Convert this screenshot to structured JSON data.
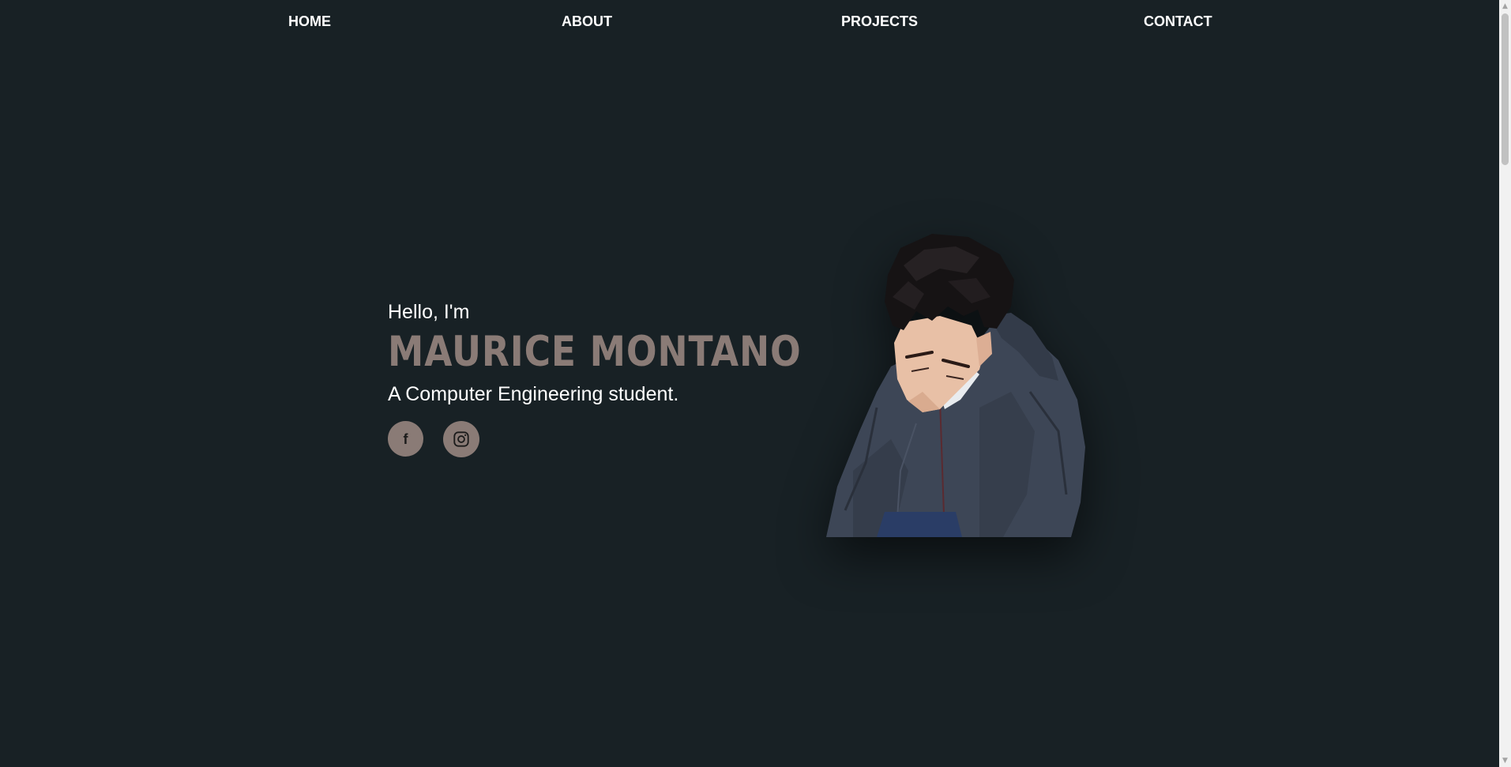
{
  "nav": {
    "home": "HOME",
    "about": "ABOUT",
    "projects": "PROJECTS",
    "contact": "CONTACT"
  },
  "hero": {
    "greeting": "Hello, I'm",
    "name": "MAURICE MONTANO",
    "tagline": "A Computer Engineering student."
  },
  "socials": {
    "facebook_glyph": "f",
    "facebook_icon": "facebook-icon",
    "instagram_icon": "instagram-icon"
  },
  "scrollbar": {
    "up_glyph": "▲",
    "down_glyph": "▼"
  },
  "colors": {
    "background": "#182125",
    "accent": "#8a7b76",
    "text": "#ffffff"
  }
}
